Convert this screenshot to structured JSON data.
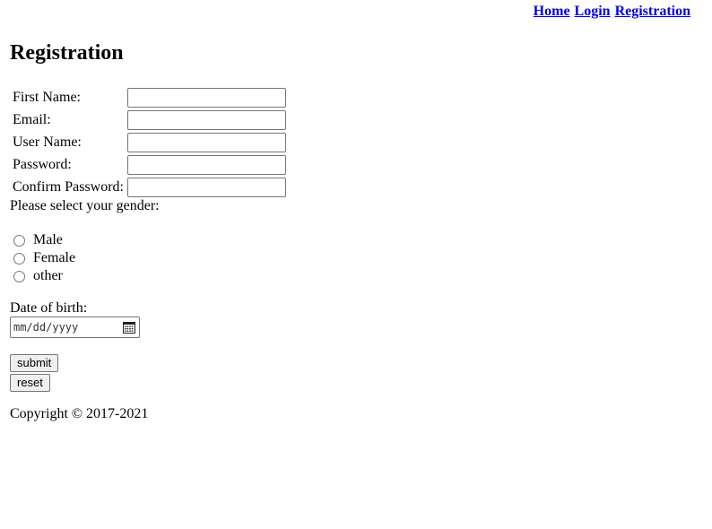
{
  "nav": {
    "home": "Home",
    "login": "Login",
    "registration": "Registration"
  },
  "page": {
    "title": "Registration"
  },
  "form": {
    "fields": [
      {
        "label": "First Name:",
        "value": ""
      },
      {
        "label": "Email:",
        "value": ""
      },
      {
        "label": "User Name:",
        "value": ""
      },
      {
        "label": "Password:",
        "value": ""
      },
      {
        "label": "Confirm Password:",
        "value": ""
      }
    ],
    "gender_prompt": "Please select your gender:",
    "gender_options": [
      "Male",
      "Female",
      "other"
    ],
    "dob_label": "Date of birth:",
    "dob_placeholder": "mm/dd/yyyy",
    "submit_label": "submit",
    "reset_label": "reset"
  },
  "footer": {
    "copyright": "Copyright © 2017-2021"
  },
  "icons": {
    "date_picker": "calendar-icon"
  }
}
